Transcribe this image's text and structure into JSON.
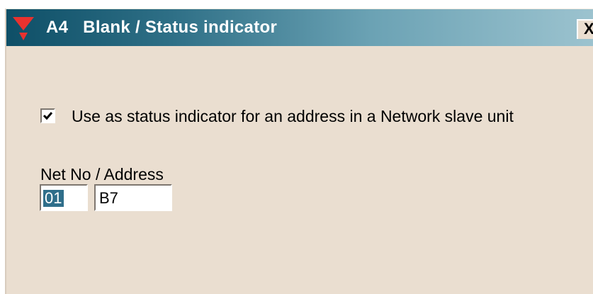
{
  "window": {
    "title": "A4   Blank / Status indicator",
    "close_label": "X"
  },
  "status_checkbox": {
    "checked": true,
    "label": "Use as status indicator for an address in a Network slave unit"
  },
  "address_fields": {
    "label": "Net No / Address",
    "net_no": "01",
    "address": "B7"
  },
  "colors": {
    "titlebar_start": "#0e4f67",
    "titlebar_end": "#9cc3cf",
    "dialog_background": "#eaded0",
    "selection_highlight": "#2f6e8a",
    "icon_red": "#e8322f"
  },
  "icons": {
    "app": "red-funnel-icon",
    "check": "checkmark-icon",
    "close": "close-icon"
  }
}
